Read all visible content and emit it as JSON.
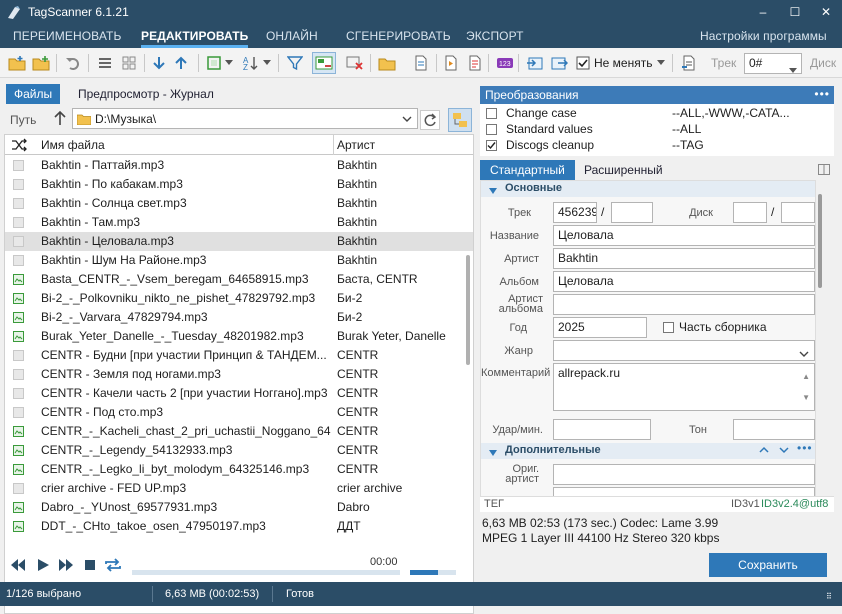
{
  "app": {
    "title": "TagScanner 6.1.21",
    "min": "–",
    "max": "☐",
    "close": "✕"
  },
  "menu": {
    "items": [
      "ПЕРЕИМЕНОВАТЬ",
      "РЕДАКТИРОВАТЬ",
      "ОНЛАЙН",
      "СГЕНЕРИРОВАТЬ",
      "ЭКСПОРТ"
    ],
    "settings": "Настройки программы"
  },
  "toolbar": {
    "mode": "Не менять",
    "track_label": "Трек",
    "track_value": "0#",
    "disc_label": "Диск"
  },
  "left": {
    "tab_files": "Файлы",
    "tab_preview": "Предпросмотр - Журнал",
    "path_label": "Путь",
    "path_value": "D:\\Музыка\\",
    "col_file": "Имя файла",
    "col_artist": "Артист"
  },
  "files": [
    {
      "name": "Bakhtin - Паттайя.mp3",
      "artist": "Bakhtin"
    },
    {
      "name": "Bakhtin - По кабакам.mp3",
      "artist": "Bakhtin"
    },
    {
      "name": "Bakhtin - Солнца свет.mp3",
      "artist": "Bakhtin"
    },
    {
      "name": "Bakhtin - Там.mp3",
      "artist": "Bakhtin"
    },
    {
      "name": "Bakhtin - Целовала.mp3",
      "artist": "Bakhtin"
    },
    {
      "name": "Bakhtin - Шум На Районе.mp3",
      "artist": "Bakhtin"
    },
    {
      "name": "Basta_CENTR_-_Vsem_beregam_64658915.mp3",
      "artist": "Баста, CENTR"
    },
    {
      "name": "Bi-2_-_Polkovniku_nikto_ne_pishet_47829792.mp3",
      "artist": "Би-2"
    },
    {
      "name": "Bi-2_-_Varvara_47829794.mp3",
      "artist": "Би-2"
    },
    {
      "name": "Burak_Yeter_Danelle_-_Tuesday_48201982.mp3",
      "artist": "Burak Yeter, Danelle"
    },
    {
      "name": "CENTR - Будни [при участии Принцип & ТАНДЕМ...",
      "artist": "CENTR"
    },
    {
      "name": "CENTR - Земля под ногами.mp3",
      "artist": "CENTR"
    },
    {
      "name": "CENTR - Качели часть 2 [при участии Ноггано].mp3",
      "artist": "CENTR"
    },
    {
      "name": "CENTR - Под сто.mp3",
      "artist": "CENTR"
    },
    {
      "name": "CENTR_-_Kacheli_chast_2_pri_uchastii_Noggano_643...",
      "artist": "CENTR"
    },
    {
      "name": "CENTR_-_Legendy_54132933.mp3",
      "artist": "CENTR"
    },
    {
      "name": "CENTR_-_Legko_li_byt_molodym_64325146.mp3",
      "artist": "CENTR"
    },
    {
      "name": "crier archive - FED UP.mp3",
      "artist": "crier archive"
    },
    {
      "name": "Dabro_-_YUnost_69577931.mp3",
      "artist": "Dabro"
    },
    {
      "name": "DDT_-_CHto_takoe_osen_47950197.mp3",
      "artist": "ДДТ"
    }
  ],
  "transforms": {
    "title": "Преобразования",
    "items": [
      {
        "name": "Change case",
        "value": "--ALL,-WWW,-CATA...",
        "checked": false
      },
      {
        "name": "Standard values",
        "value": "--ALL",
        "checked": false
      },
      {
        "name": "Discogs cleanup",
        "value": "--TAG",
        "checked": true
      }
    ]
  },
  "editor": {
    "tab_std": "Стандартный",
    "tab_ext": "Расширенный",
    "sec_basic": "Основные",
    "sec_extra": "Дополнительные",
    "track_label": "Трек",
    "track_value": "456239:",
    "disc_label": "Диск",
    "title_label": "Название",
    "title_value": "Целовала",
    "artist_label": "Артист",
    "artist_value": "Bakhtin",
    "album_label": "Альбом",
    "album_value": "Целовала",
    "album_artist_label": "Артист альбома",
    "year_label": "Год",
    "year_value": "2025",
    "compilation": "Часть сборника",
    "genre_label": "Жанр",
    "comment_label": "Комментарий",
    "comment_value": "allrepack.ru",
    "bpm_label": "Удар/мин.",
    "key_label": "Тон",
    "orig_artist_label": "Ориг. артист",
    "tag_label": "ТЕГ",
    "id3v1": "ID3v1",
    "id3v2": "ID3v2.4@utf8"
  },
  "info": {
    "line1": "6,63 MB  02:53 (173 sec.)  Codec: Lame 3.99",
    "line2": "MPEG 1 Layer III  44100 Hz  Stereo  320 kbps"
  },
  "player": {
    "time": "00:00",
    "progress": 0,
    "volume": 0.6
  },
  "save": "Сохранить",
  "status": {
    "selected": "1/126 выбрано",
    "size": "6,63 MB (00:02:53)",
    "state": "Готов"
  }
}
